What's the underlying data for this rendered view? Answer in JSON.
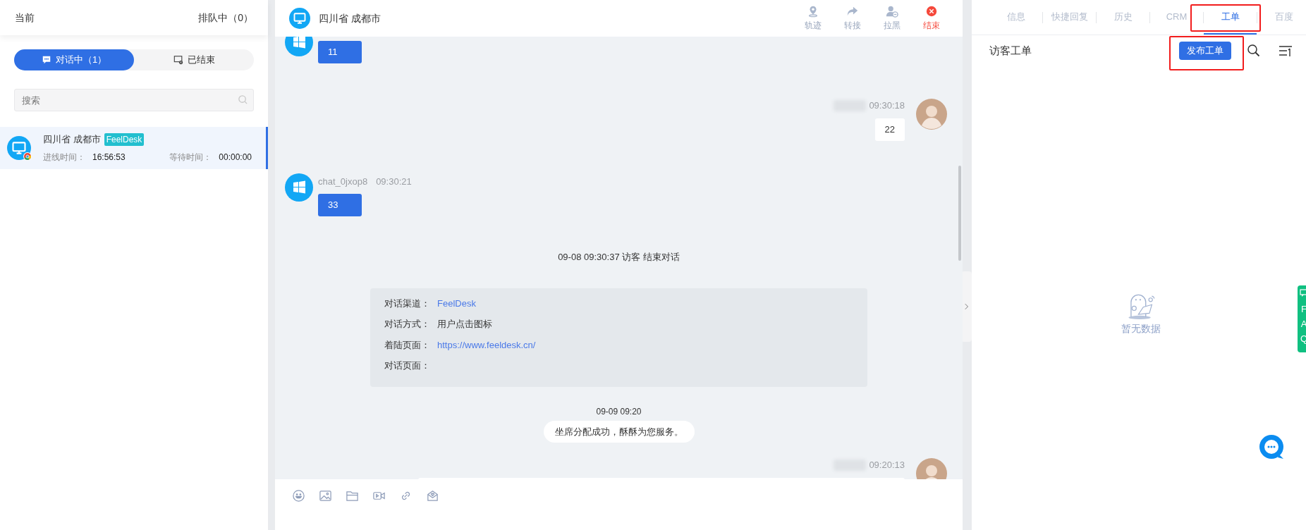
{
  "left": {
    "title": "当前",
    "queue": "排队中（0）",
    "tabs": [
      {
        "label": "对话中（1）",
        "selected": true,
        "kind": "chat"
      },
      {
        "label": "已结束",
        "selected": false,
        "kind": "ended"
      }
    ],
    "search": {
      "placeholder": "搜索"
    },
    "sessions": [
      {
        "location": "四川省 成都市",
        "tag": "FeelDesk",
        "in_label": "进线时间：",
        "in_time": "16:56:53",
        "wait_label": "等待时间：",
        "wait_time": "00:00:00",
        "selected": true
      }
    ]
  },
  "chat": {
    "title": "四川省 成都市",
    "actions": [
      {
        "label": "轨迹",
        "kind": "track"
      },
      {
        "label": "转接",
        "kind": "transfer"
      },
      {
        "label": "拉黑",
        "kind": "block"
      },
      {
        "label": "结束",
        "kind": "end"
      }
    ],
    "messages": [
      {
        "kind": "visitor",
        "text": "11"
      },
      {
        "kind": "agent",
        "time": "09:30:18",
        "text": "22"
      },
      {
        "kind": "visitor",
        "name": "chat_0jxop8",
        "time": "09:30:21",
        "text": "33"
      },
      {
        "kind": "event",
        "text": "09-08 09:30:37 访客 结束对话"
      },
      {
        "kind": "info",
        "rows": [
          {
            "label": "对话渠道：",
            "value": "FeelDesk",
            "link": true
          },
          {
            "label": "对话方式：",
            "value": "用户点击图标",
            "link": false
          },
          {
            "label": "着陆页面：",
            "value": "https://www.feeldesk.cn/",
            "link": true
          },
          {
            "label": "对话页面："
          }
        ]
      },
      {
        "kind": "time",
        "text": "09-09 09:20"
      },
      {
        "kind": "notice",
        "text": "坐席分配成功，酥酥为您服务。"
      },
      {
        "kind": "agent",
        "time": "09:20:13"
      }
    ]
  },
  "right": {
    "tabs": [
      {
        "label": "信息",
        "selected": false
      },
      {
        "label": "快捷回复",
        "selected": false
      },
      {
        "label": "历史",
        "selected": false
      },
      {
        "label": "CRM",
        "selected": false
      },
      {
        "label": "工单",
        "selected": true
      },
      {
        "label": "百度",
        "selected": false
      }
    ],
    "title": "访客工单",
    "publish_button": "发布工单",
    "empty": "暂无数据",
    "faq": [
      "F",
      "A",
      "Q"
    ]
  }
}
